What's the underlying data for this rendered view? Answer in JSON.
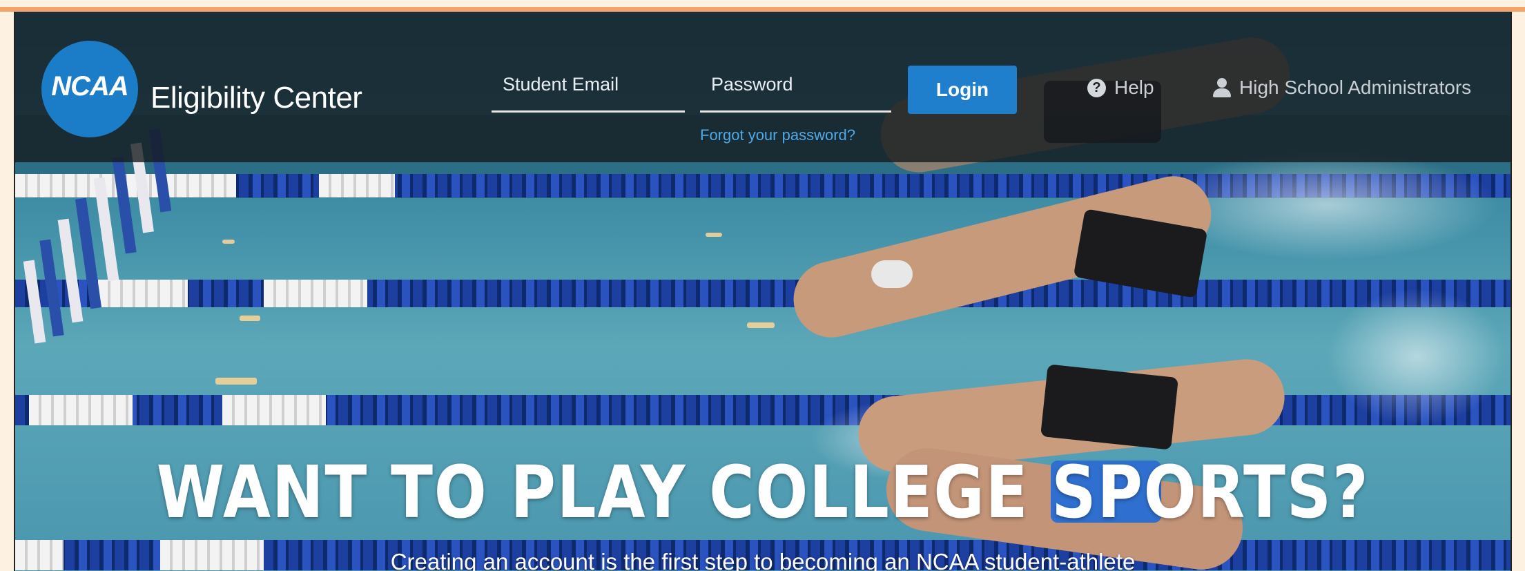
{
  "header": {
    "logo_text": "NCAA",
    "brand_title": "Eligibility Center",
    "login_form": {
      "email_label": "Student Email",
      "password_label": "Password",
      "forgot_link": "Forgot your password?",
      "login_button": "Login"
    },
    "nav": {
      "help": "Help",
      "help_icon": "question-circle-icon",
      "admins": "High School Administrators",
      "admins_icon": "user-icon"
    }
  },
  "hero": {
    "title": "WANT TO PLAY COLLEGE SPORTS?",
    "subtitle": "Creating an account is the first step to becoming an NCAA student-athlete"
  },
  "colors": {
    "brand_blue": "#1b7cc8",
    "button_blue": "#1f7fcc",
    "link_blue": "#4fa8e8",
    "header_overlay": "#14181c"
  }
}
